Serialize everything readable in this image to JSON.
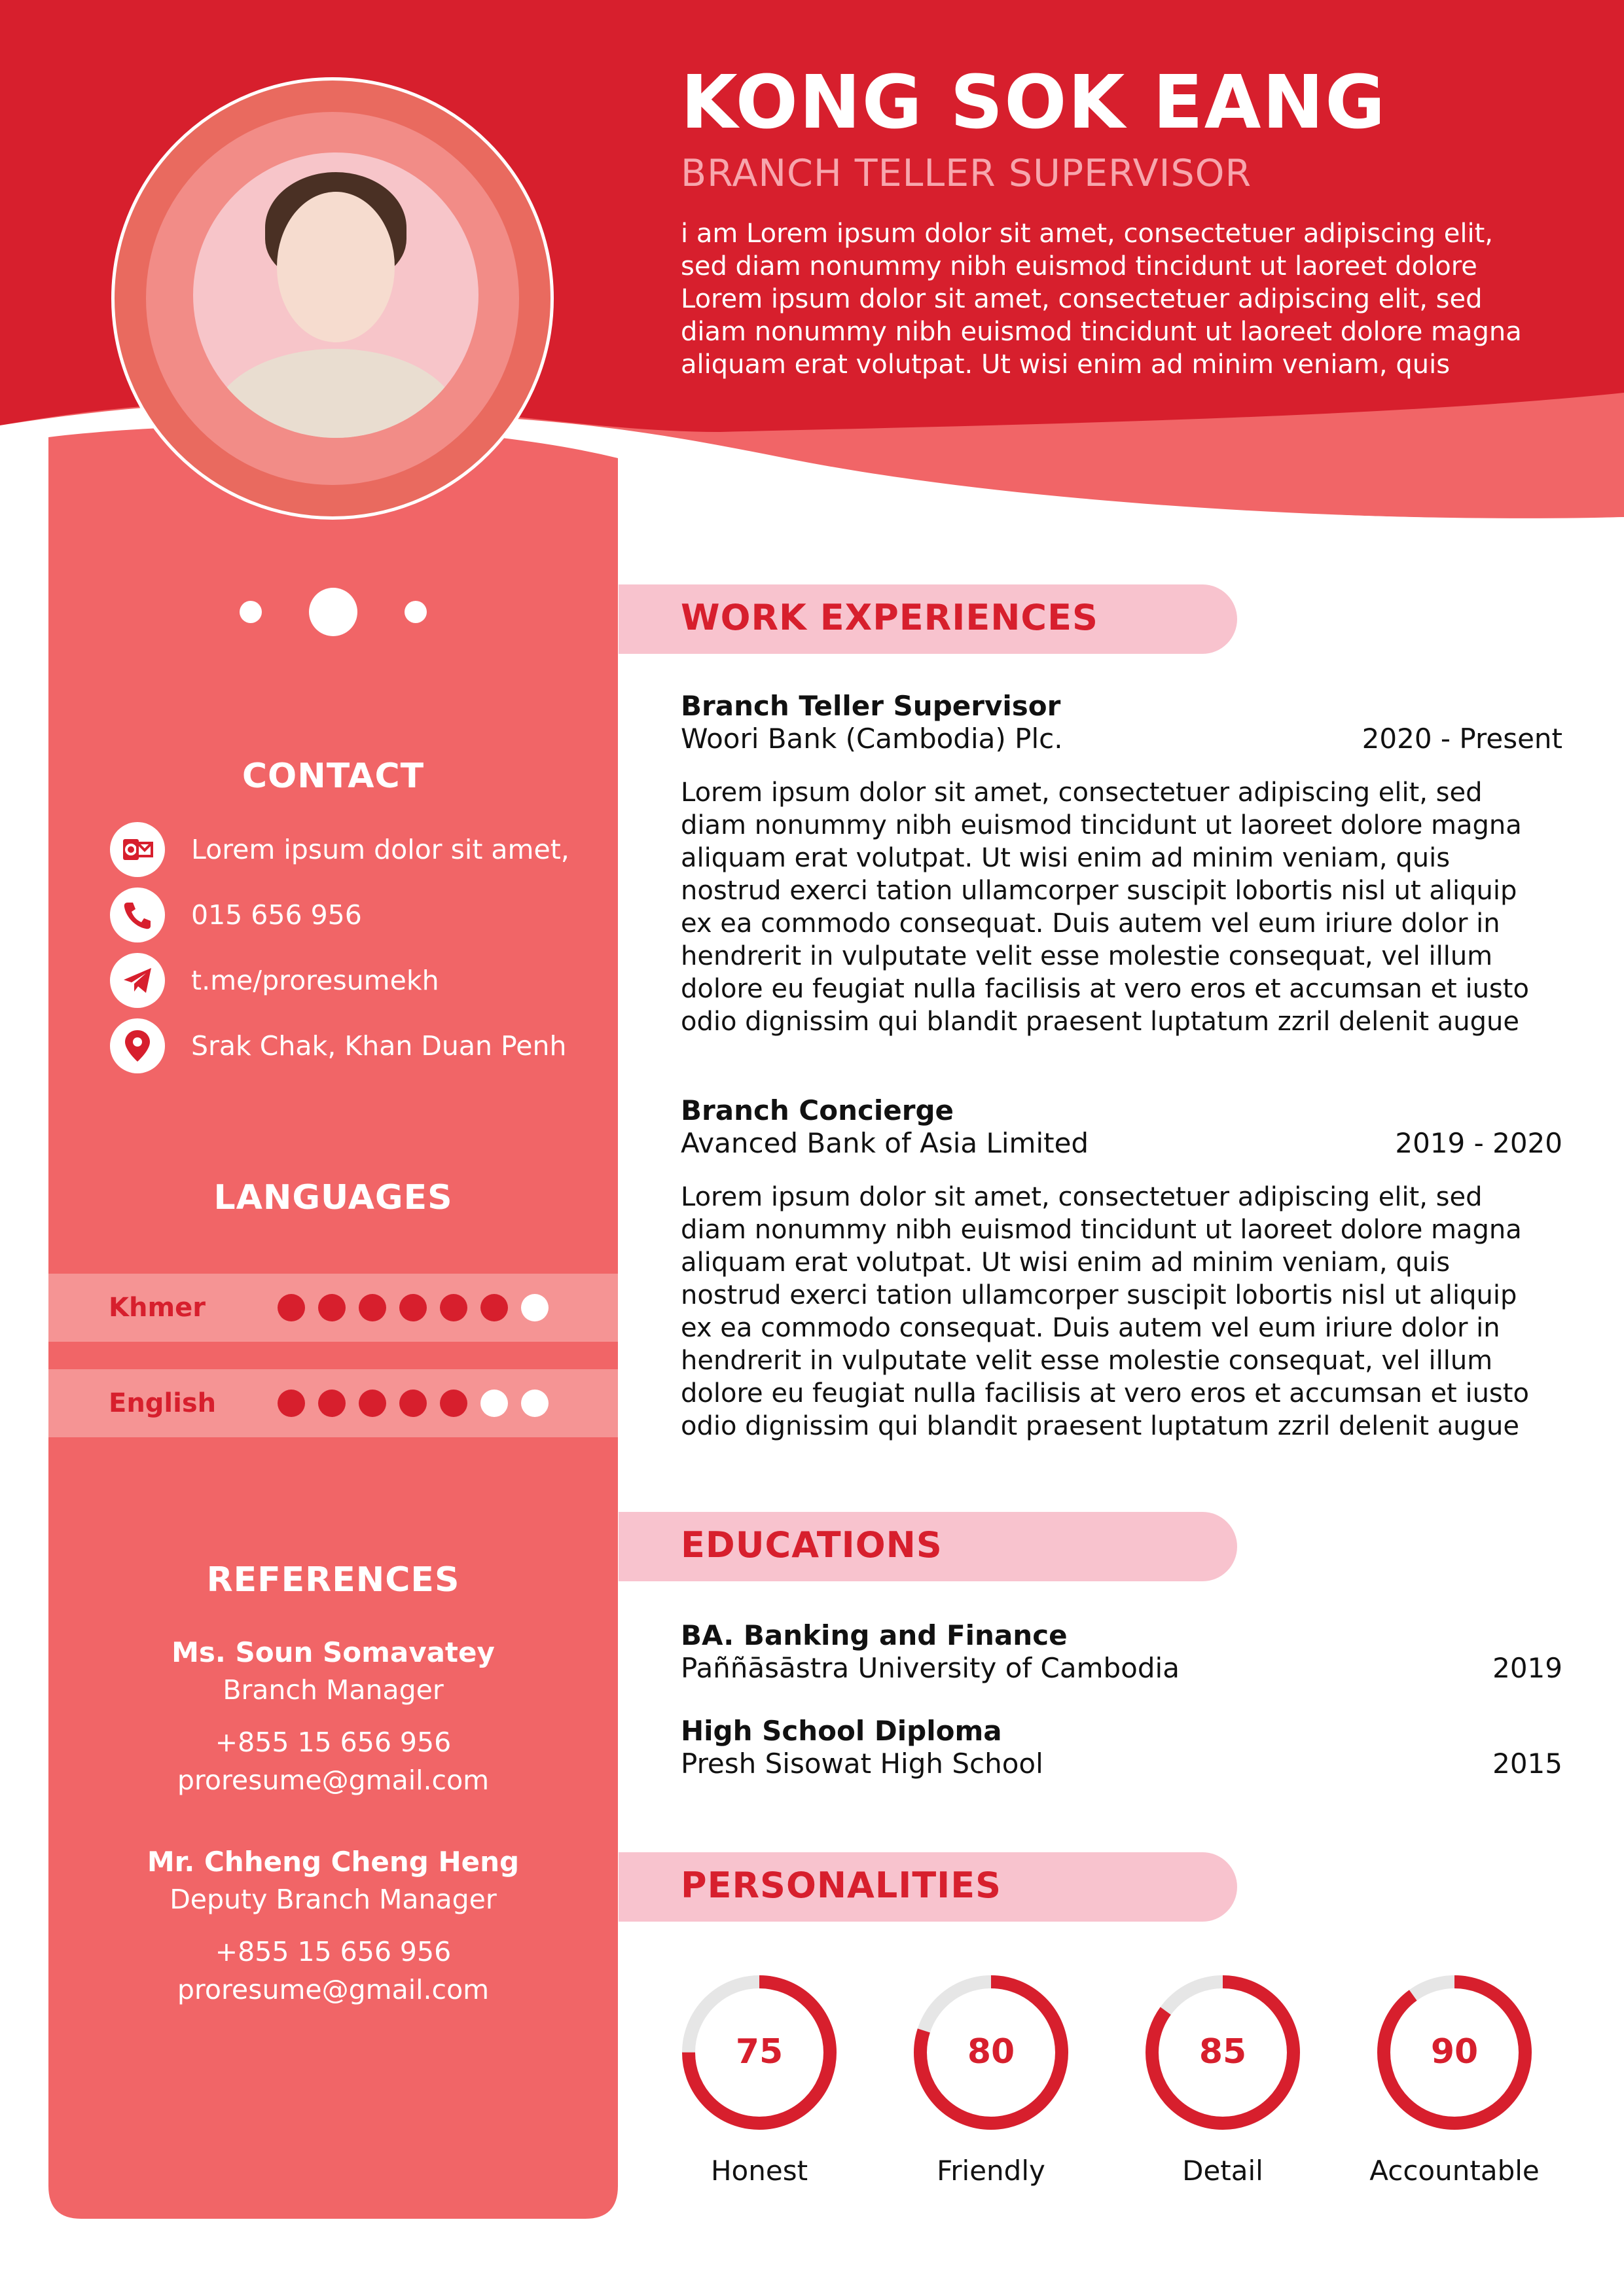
{
  "header": {
    "name": "KONG SOK EANG",
    "role": "BRANCH TELLER SUPERVISOR",
    "intro": "i am Lorem ipsum dolor sit amet, consectetuer adipiscing elit,\nsed diam nonummy nibh euismod tincidunt ut laoreet dolore\nLorem ipsum dolor sit amet, consectetuer adipiscing elit, sed\ndiam nonummy nibh euismod tincidunt ut laoreet dolore magna\naliquam erat volutpat. Ut wisi enim ad minim veniam, quis"
  },
  "contact": {
    "title": "CONTACT",
    "items": [
      {
        "icon": "outlook-mail-icon",
        "text": "Lorem ipsum dolor sit amet,"
      },
      {
        "icon": "phone-icon",
        "text": "015 656 956"
      },
      {
        "icon": "telegram-icon",
        "text": "t.me/proresumekh"
      },
      {
        "icon": "location-pin-icon",
        "text": "Srak Chak, Khan Duan Penh"
      }
    ]
  },
  "languages": {
    "title": "LANGUAGES",
    "items": [
      {
        "name": "Khmer",
        "level": 6,
        "max": 7
      },
      {
        "name": "English",
        "level": 5,
        "max": 7
      }
    ]
  },
  "references": {
    "title": "REFERENCES",
    "items": [
      {
        "name": "Ms. Soun Somavatey",
        "position": "Branch Manager",
        "phone": "+855 15 656 956",
        "email": "proresume@gmail.com"
      },
      {
        "name": "Mr. Chheng Cheng Heng",
        "position": "Deputy Branch Manager",
        "phone": "+855 15 656 956",
        "email": "proresume@gmail.com"
      }
    ]
  },
  "work": {
    "title": "WORK EXPERIENCES",
    "items": [
      {
        "title": "Branch Teller Supervisor",
        "org": "Woori Bank (Cambodia) Plc.",
        "period": "2020 - Present",
        "desc": "Lorem ipsum dolor sit amet, consectetuer adipiscing elit, sed\ndiam nonummy nibh euismod tincidunt ut laoreet dolore magna\naliquam erat volutpat. Ut wisi enim ad minim veniam, quis\nnostrud exerci tation ullamcorper suscipit lobortis nisl ut aliquip\nex ea commodo consequat. Duis autem vel eum iriure dolor in\nhendrerit in vulputate velit esse molestie consequat, vel illum\ndolore eu feugiat nulla facilisis at vero eros et accumsan et iusto\nodio dignissim qui blandit praesent luptatum zzril delenit augue"
      },
      {
        "title": "Branch Concierge",
        "org": "Avanced Bank of Asia Limited",
        "period": "2019 - 2020",
        "desc": "Lorem ipsum dolor sit amet, consectetuer adipiscing elit, sed\ndiam nonummy nibh euismod tincidunt ut laoreet dolore magna\naliquam erat volutpat. Ut wisi enim ad minim veniam, quis\nnostrud exerci tation ullamcorper suscipit lobortis nisl ut aliquip\nex ea commodo consequat. Duis autem vel eum iriure dolor in\nhendrerit in vulputate velit esse molestie consequat, vel illum\ndolore eu feugiat nulla facilisis at vero eros et accumsan et iusto\nodio dignissim qui blandit praesent luptatum zzril delenit augue"
      }
    ]
  },
  "education": {
    "title": "EDUCATIONS",
    "items": [
      {
        "degree": "BA. Banking and Finance",
        "school": "Paññāsāstra University of Cambodia",
        "year": "2019"
      },
      {
        "degree": "High School Diploma",
        "school": "Presh Sisowat High School",
        "year": "2015"
      }
    ]
  },
  "personalities": {
    "title": "PERSONALITIES",
    "items": [
      {
        "value": 75,
        "label": "Honest"
      },
      {
        "value": 80,
        "label": "Friendly"
      },
      {
        "value": 85,
        "label": "Detail"
      },
      {
        "value": 90,
        "label": "Accountable"
      }
    ]
  },
  "colors": {
    "primary": "#d71f2d",
    "sidebar": "#f16567",
    "section_bar": "#f8c3ce",
    "track": "#e6e6e6"
  }
}
